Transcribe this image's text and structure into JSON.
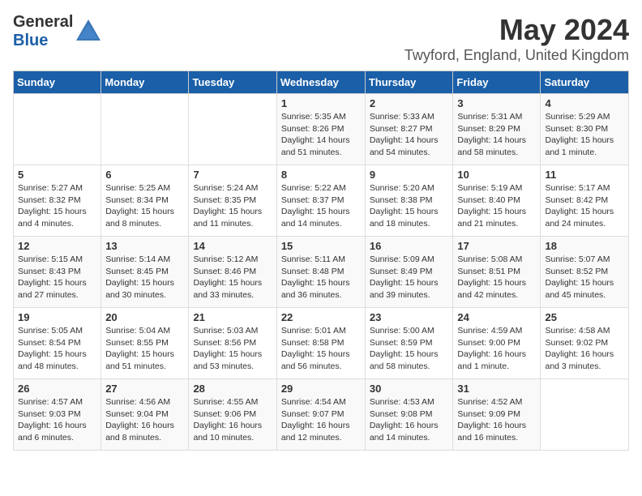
{
  "header": {
    "logo_general": "General",
    "logo_blue": "Blue",
    "month": "May 2024",
    "location": "Twyford, England, United Kingdom"
  },
  "weekdays": [
    "Sunday",
    "Monday",
    "Tuesday",
    "Wednesday",
    "Thursday",
    "Friday",
    "Saturday"
  ],
  "weeks": [
    [
      {
        "day": "",
        "info": ""
      },
      {
        "day": "",
        "info": ""
      },
      {
        "day": "",
        "info": ""
      },
      {
        "day": "1",
        "info": "Sunrise: 5:35 AM\nSunset: 8:26 PM\nDaylight: 14 hours\nand 51 minutes."
      },
      {
        "day": "2",
        "info": "Sunrise: 5:33 AM\nSunset: 8:27 PM\nDaylight: 14 hours\nand 54 minutes."
      },
      {
        "day": "3",
        "info": "Sunrise: 5:31 AM\nSunset: 8:29 PM\nDaylight: 14 hours\nand 58 minutes."
      },
      {
        "day": "4",
        "info": "Sunrise: 5:29 AM\nSunset: 8:30 PM\nDaylight: 15 hours\nand 1 minute."
      }
    ],
    [
      {
        "day": "5",
        "info": "Sunrise: 5:27 AM\nSunset: 8:32 PM\nDaylight: 15 hours\nand 4 minutes."
      },
      {
        "day": "6",
        "info": "Sunrise: 5:25 AM\nSunset: 8:34 PM\nDaylight: 15 hours\nand 8 minutes."
      },
      {
        "day": "7",
        "info": "Sunrise: 5:24 AM\nSunset: 8:35 PM\nDaylight: 15 hours\nand 11 minutes."
      },
      {
        "day": "8",
        "info": "Sunrise: 5:22 AM\nSunset: 8:37 PM\nDaylight: 15 hours\nand 14 minutes."
      },
      {
        "day": "9",
        "info": "Sunrise: 5:20 AM\nSunset: 8:38 PM\nDaylight: 15 hours\nand 18 minutes."
      },
      {
        "day": "10",
        "info": "Sunrise: 5:19 AM\nSunset: 8:40 PM\nDaylight: 15 hours\nand 21 minutes."
      },
      {
        "day": "11",
        "info": "Sunrise: 5:17 AM\nSunset: 8:42 PM\nDaylight: 15 hours\nand 24 minutes."
      }
    ],
    [
      {
        "day": "12",
        "info": "Sunrise: 5:15 AM\nSunset: 8:43 PM\nDaylight: 15 hours\nand 27 minutes."
      },
      {
        "day": "13",
        "info": "Sunrise: 5:14 AM\nSunset: 8:45 PM\nDaylight: 15 hours\nand 30 minutes."
      },
      {
        "day": "14",
        "info": "Sunrise: 5:12 AM\nSunset: 8:46 PM\nDaylight: 15 hours\nand 33 minutes."
      },
      {
        "day": "15",
        "info": "Sunrise: 5:11 AM\nSunset: 8:48 PM\nDaylight: 15 hours\nand 36 minutes."
      },
      {
        "day": "16",
        "info": "Sunrise: 5:09 AM\nSunset: 8:49 PM\nDaylight: 15 hours\nand 39 minutes."
      },
      {
        "day": "17",
        "info": "Sunrise: 5:08 AM\nSunset: 8:51 PM\nDaylight: 15 hours\nand 42 minutes."
      },
      {
        "day": "18",
        "info": "Sunrise: 5:07 AM\nSunset: 8:52 PM\nDaylight: 15 hours\nand 45 minutes."
      }
    ],
    [
      {
        "day": "19",
        "info": "Sunrise: 5:05 AM\nSunset: 8:54 PM\nDaylight: 15 hours\nand 48 minutes."
      },
      {
        "day": "20",
        "info": "Sunrise: 5:04 AM\nSunset: 8:55 PM\nDaylight: 15 hours\nand 51 minutes."
      },
      {
        "day": "21",
        "info": "Sunrise: 5:03 AM\nSunset: 8:56 PM\nDaylight: 15 hours\nand 53 minutes."
      },
      {
        "day": "22",
        "info": "Sunrise: 5:01 AM\nSunset: 8:58 PM\nDaylight: 15 hours\nand 56 minutes."
      },
      {
        "day": "23",
        "info": "Sunrise: 5:00 AM\nSunset: 8:59 PM\nDaylight: 15 hours\nand 58 minutes."
      },
      {
        "day": "24",
        "info": "Sunrise: 4:59 AM\nSunset: 9:00 PM\nDaylight: 16 hours\nand 1 minute."
      },
      {
        "day": "25",
        "info": "Sunrise: 4:58 AM\nSunset: 9:02 PM\nDaylight: 16 hours\nand 3 minutes."
      }
    ],
    [
      {
        "day": "26",
        "info": "Sunrise: 4:57 AM\nSunset: 9:03 PM\nDaylight: 16 hours\nand 6 minutes."
      },
      {
        "day": "27",
        "info": "Sunrise: 4:56 AM\nSunset: 9:04 PM\nDaylight: 16 hours\nand 8 minutes."
      },
      {
        "day": "28",
        "info": "Sunrise: 4:55 AM\nSunset: 9:06 PM\nDaylight: 16 hours\nand 10 minutes."
      },
      {
        "day": "29",
        "info": "Sunrise: 4:54 AM\nSunset: 9:07 PM\nDaylight: 16 hours\nand 12 minutes."
      },
      {
        "day": "30",
        "info": "Sunrise: 4:53 AM\nSunset: 9:08 PM\nDaylight: 16 hours\nand 14 minutes."
      },
      {
        "day": "31",
        "info": "Sunrise: 4:52 AM\nSunset: 9:09 PM\nDaylight: 16 hours\nand 16 minutes."
      },
      {
        "day": "",
        "info": ""
      }
    ]
  ]
}
